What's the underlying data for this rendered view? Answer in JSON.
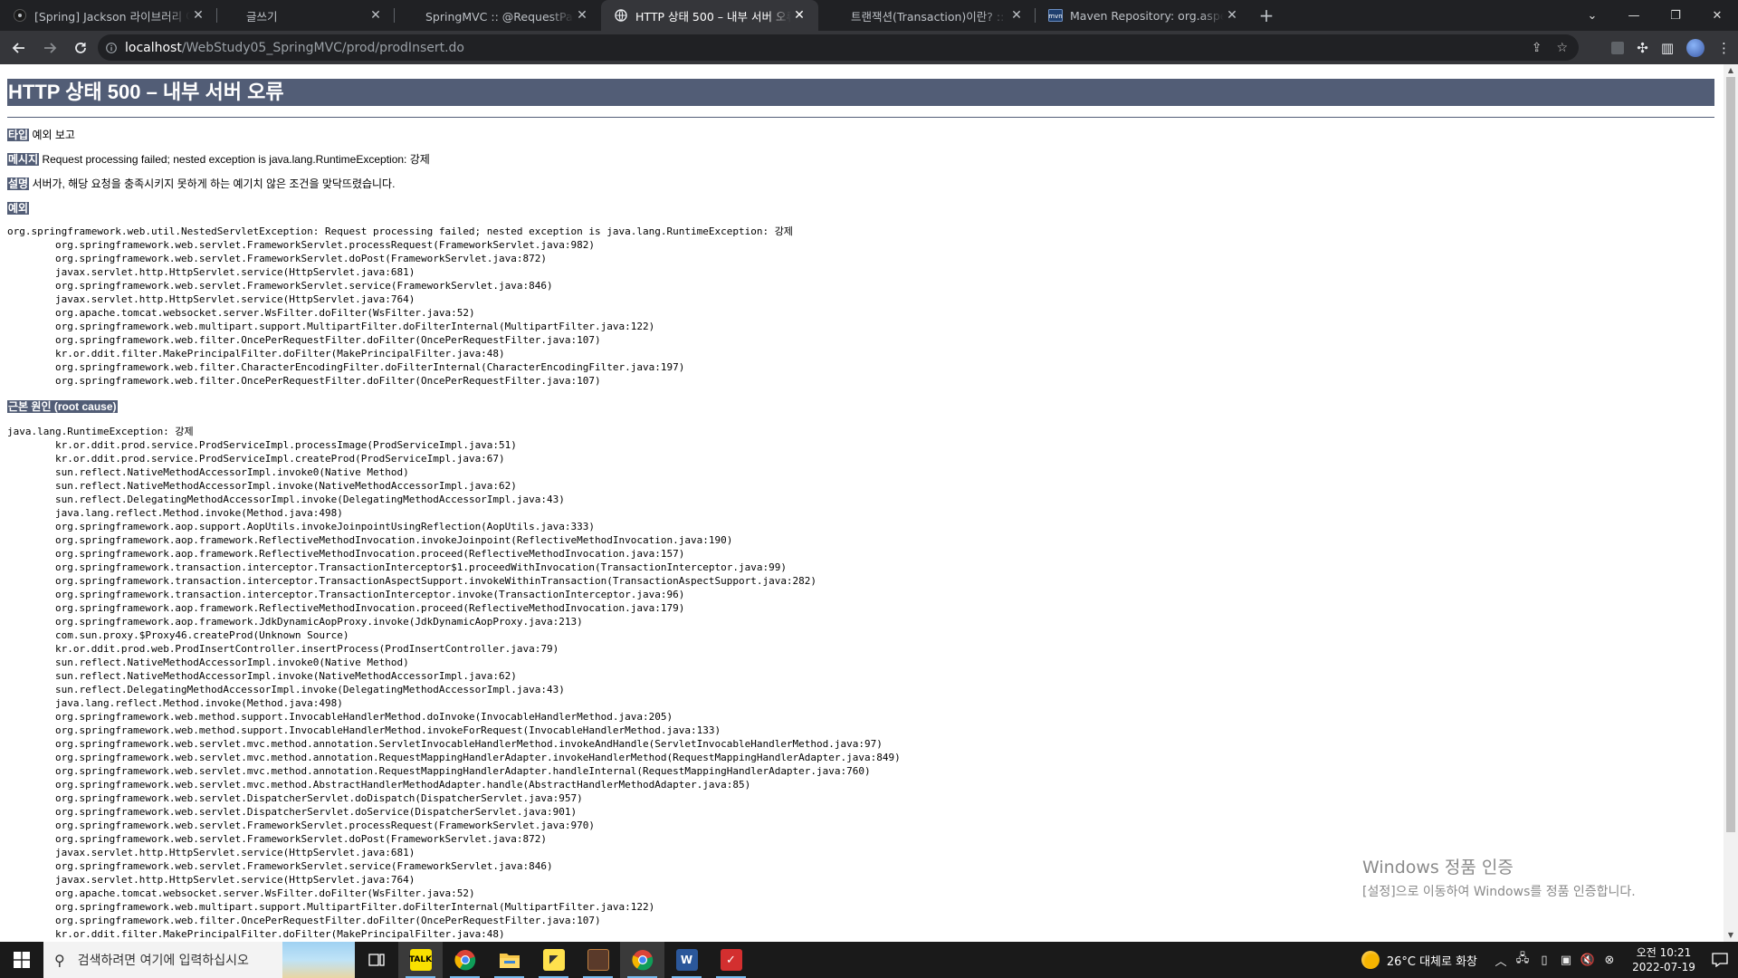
{
  "browser": {
    "tabs": [
      {
        "title": "[Spring] Jackson 라이브러리 이해",
        "favicon": "tistory-icon",
        "active": false
      },
      {
        "title": "글쓰기",
        "favicon": "none",
        "active": false
      },
      {
        "title": "SpringMVC :: @RequestParam 종",
        "favicon": "none",
        "active": false
      },
      {
        "title": "HTTP 상태 500 – 내부 서버 오류",
        "favicon": "globe-icon",
        "active": true
      },
      {
        "title": "트랜잭션(Transaction)이란? :: 개",
        "favicon": "none",
        "active": false
      },
      {
        "title": "Maven Repository: org.aspectj »",
        "favicon": "mvn-icon",
        "active": false
      }
    ],
    "new_tab": "+",
    "url_host": "localhost",
    "url_path": "/WebStudy05_SpringMVC/prod/prodInsert.do"
  },
  "page": {
    "heading": "HTTP 상태 500 – 내부 서버 오류",
    "type_label": "타입",
    "type_value": "예외 보고",
    "message_label": "메시지",
    "message_value": "Request processing failed; nested exception is java.lang.RuntimeException: 강제",
    "description_label": "설명",
    "description_value": "서버가, 해당 요청을 충족시키지 못하게 하는 예기치 않은 조건을 맞닥뜨렸습니다.",
    "exception_label": "예외",
    "exception_trace": "org.springframework.web.util.NestedServletException: Request processing failed; nested exception is java.lang.RuntimeException: 강제\n\torg.springframework.web.servlet.FrameworkServlet.processRequest(FrameworkServlet.java:982)\n\torg.springframework.web.servlet.FrameworkServlet.doPost(FrameworkServlet.java:872)\n\tjavax.servlet.http.HttpServlet.service(HttpServlet.java:681)\n\torg.springframework.web.servlet.FrameworkServlet.service(FrameworkServlet.java:846)\n\tjavax.servlet.http.HttpServlet.service(HttpServlet.java:764)\n\torg.apache.tomcat.websocket.server.WsFilter.doFilter(WsFilter.java:52)\n\torg.springframework.web.multipart.support.MultipartFilter.doFilterInternal(MultipartFilter.java:122)\n\torg.springframework.web.filter.OncePerRequestFilter.doFilter(OncePerRequestFilter.java:107)\n\tkr.or.ddit.filter.MakePrincipalFilter.doFilter(MakePrincipalFilter.java:48)\n\torg.springframework.web.filter.CharacterEncodingFilter.doFilterInternal(CharacterEncodingFilter.java:197)\n\torg.springframework.web.filter.OncePerRequestFilter.doFilter(OncePerRequestFilter.java:107)",
    "root_cause_label": "근본 원인 (root cause)",
    "root_cause_trace": "java.lang.RuntimeException: 강제\n\tkr.or.ddit.prod.service.ProdServiceImpl.processImage(ProdServiceImpl.java:51)\n\tkr.or.ddit.prod.service.ProdServiceImpl.createProd(ProdServiceImpl.java:67)\n\tsun.reflect.NativeMethodAccessorImpl.invoke0(Native Method)\n\tsun.reflect.NativeMethodAccessorImpl.invoke(NativeMethodAccessorImpl.java:62)\n\tsun.reflect.DelegatingMethodAccessorImpl.invoke(DelegatingMethodAccessorImpl.java:43)\n\tjava.lang.reflect.Method.invoke(Method.java:498)\n\torg.springframework.aop.support.AopUtils.invokeJoinpointUsingReflection(AopUtils.java:333)\n\torg.springframework.aop.framework.ReflectiveMethodInvocation.invokeJoinpoint(ReflectiveMethodInvocation.java:190)\n\torg.springframework.aop.framework.ReflectiveMethodInvocation.proceed(ReflectiveMethodInvocation.java:157)\n\torg.springframework.transaction.interceptor.TransactionInterceptor$1.proceedWithInvocation(TransactionInterceptor.java:99)\n\torg.springframework.transaction.interceptor.TransactionAspectSupport.invokeWithinTransaction(TransactionAspectSupport.java:282)\n\torg.springframework.transaction.interceptor.TransactionInterceptor.invoke(TransactionInterceptor.java:96)\n\torg.springframework.aop.framework.ReflectiveMethodInvocation.proceed(ReflectiveMethodInvocation.java:179)\n\torg.springframework.aop.framework.JdkDynamicAopProxy.invoke(JdkDynamicAopProxy.java:213)\n\tcom.sun.proxy.$Proxy46.createProd(Unknown Source)\n\tkr.or.ddit.prod.web.ProdInsertController.insertProcess(ProdInsertController.java:79)\n\tsun.reflect.NativeMethodAccessorImpl.invoke0(Native Method)\n\tsun.reflect.NativeMethodAccessorImpl.invoke(NativeMethodAccessorImpl.java:62)\n\tsun.reflect.DelegatingMethodAccessorImpl.invoke(DelegatingMethodAccessorImpl.java:43)\n\tjava.lang.reflect.Method.invoke(Method.java:498)\n\torg.springframework.web.method.support.InvocableHandlerMethod.doInvoke(InvocableHandlerMethod.java:205)\n\torg.springframework.web.method.support.InvocableHandlerMethod.invokeForRequest(InvocableHandlerMethod.java:133)\n\torg.springframework.web.servlet.mvc.method.annotation.ServletInvocableHandlerMethod.invokeAndHandle(ServletInvocableHandlerMethod.java:97)\n\torg.springframework.web.servlet.mvc.method.annotation.RequestMappingHandlerAdapter.invokeHandlerMethod(RequestMappingHandlerAdapter.java:849)\n\torg.springframework.web.servlet.mvc.method.annotation.RequestMappingHandlerAdapter.handleInternal(RequestMappingHandlerAdapter.java:760)\n\torg.springframework.web.servlet.mvc.method.AbstractHandlerMethodAdapter.handle(AbstractHandlerMethodAdapter.java:85)\n\torg.springframework.web.servlet.DispatcherServlet.doDispatch(DispatcherServlet.java:957)\n\torg.springframework.web.servlet.DispatcherServlet.doService(DispatcherServlet.java:901)\n\torg.springframework.web.servlet.FrameworkServlet.processRequest(FrameworkServlet.java:970)\n\torg.springframework.web.servlet.FrameworkServlet.doPost(FrameworkServlet.java:872)\n\tjavax.servlet.http.HttpServlet.service(HttpServlet.java:681)\n\torg.springframework.web.servlet.FrameworkServlet.service(FrameworkServlet.java:846)\n\tjavax.servlet.http.HttpServlet.service(HttpServlet.java:764)\n\torg.apache.tomcat.websocket.server.WsFilter.doFilter(WsFilter.java:52)\n\torg.springframework.web.multipart.support.MultipartFilter.doFilterInternal(MultipartFilter.java:122)\n\torg.springframework.web.filter.OncePerRequestFilter.doFilter(OncePerRequestFilter.java:107)\n\tkr.or.ddit.filter.MakePrincipalFilter.doFilter(MakePrincipalFilter.java:48)"
  },
  "watermark": {
    "title": "Windows 정품 인증",
    "subtitle": "[설정]으로 이동하여 Windows를 정품 인증합니다."
  },
  "taskbar": {
    "search_placeholder": "검색하려면 여기에 입력하십시오",
    "apps": [
      "kakaotalk-icon",
      "chrome-icon",
      "file-explorer-icon",
      "sticky-notes-icon",
      "game-icon",
      "chrome-active-icon",
      "word-icon",
      "acrobat-icon"
    ],
    "weather": "26°C 대체로 화창",
    "time": "오전 10:21",
    "date": "2022-07-19"
  },
  "colors": {
    "tomcat_header": "#525d76",
    "tab_bar": "#202124",
    "toolbar": "#35363a"
  }
}
